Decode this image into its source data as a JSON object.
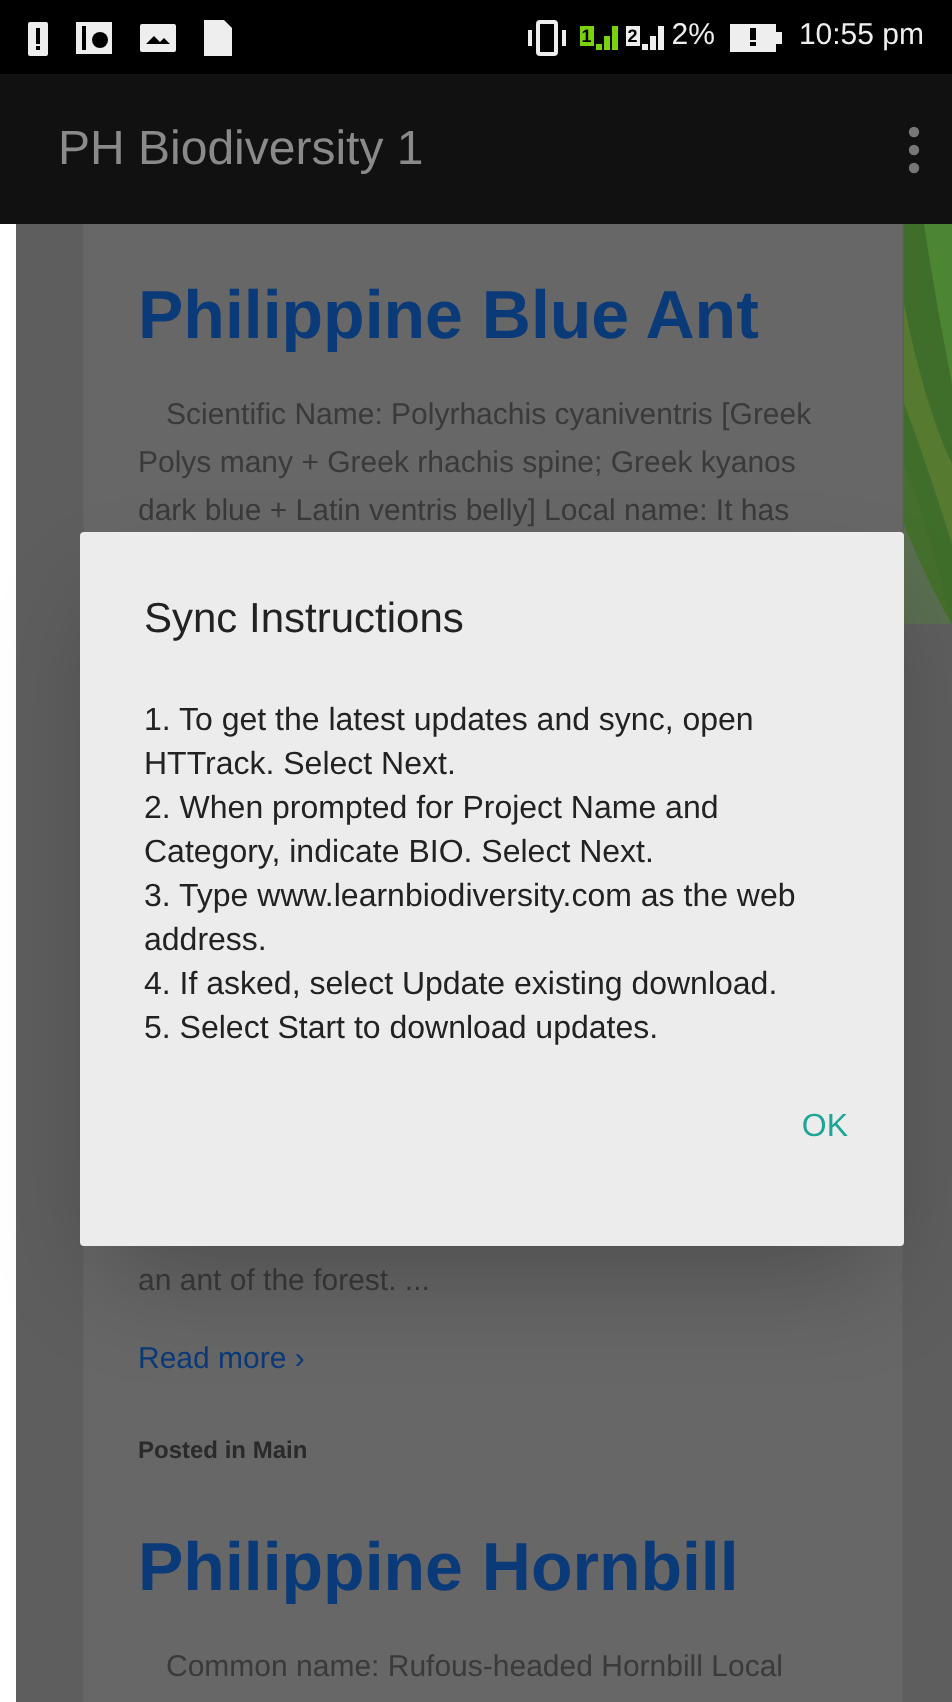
{
  "status_bar": {
    "sims": [
      {
        "label": "1",
        "active": true
      },
      {
        "label": "2",
        "active": false
      }
    ],
    "battery_percent": "2%",
    "time": "10:55 pm"
  },
  "app_bar": {
    "title": "PH Biodiversity 1"
  },
  "posts": [
    {
      "title": "Philippine Blue Ant",
      "excerpt": "Scientific Name: Polyrhachis cyaniventris [Greek Polys many + Greek rhachis spine; Greek kyanos dark blue + Latin ventris belly] Local name: It has",
      "tail": "an ant of the forest.  ...",
      "read_more": "Read more ›",
      "posted_in": "Posted in Main"
    },
    {
      "title": "Philippine Hornbill",
      "excerpt": "Common name: Rufous-headed Hornbill Local"
    }
  ],
  "dialog": {
    "title": "Sync Instructions",
    "steps": [
      "1. To get the latest updates and sync, open HTTrack. Select Next.",
      "2. When prompted for Project Name and Category, indicate BIO. Select Next.",
      "3. Type www.learnbiodiversity.com as the web address.",
      "4. If asked, select Update existing download.",
      "5. Select Start to download updates."
    ],
    "button": "OK"
  }
}
